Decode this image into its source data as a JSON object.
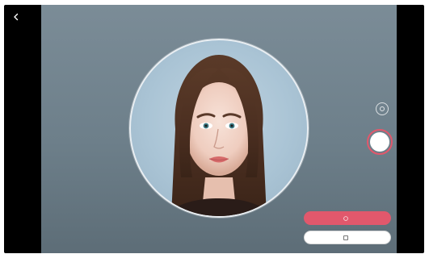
{
  "app": {
    "back_icon": "chevron-left-icon"
  },
  "camera": {
    "subject": "portrait-photo"
  },
  "controls": {
    "mode_icon": "camera-mode-icon",
    "shutter_icon": "shutter-button",
    "primary_label": "",
    "secondary_label": "",
    "hint_text": ""
  },
  "colors": {
    "accent": "#e1586c",
    "background": "#6f808b",
    "frame": "#000000"
  }
}
